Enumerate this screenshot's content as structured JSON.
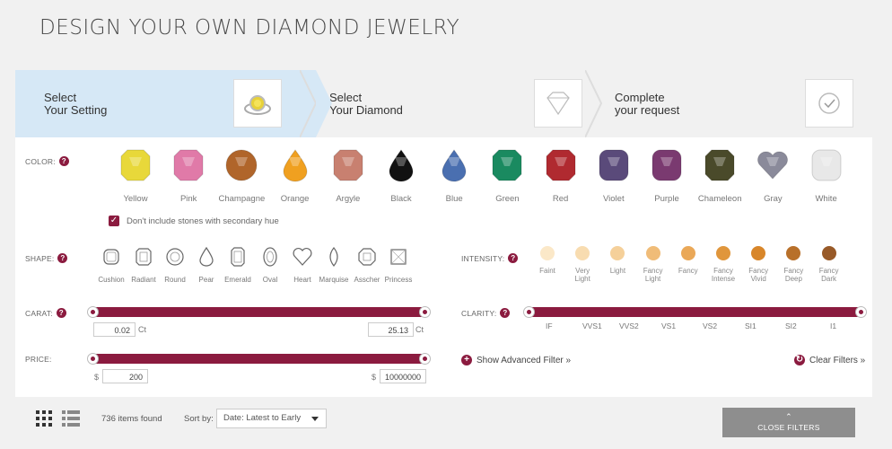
{
  "page": {
    "title": "DESIGN YOUR OWN DIAMOND JEWELRY"
  },
  "steps": [
    {
      "line1": "Select",
      "line2": "Your Setting"
    },
    {
      "line1": "Select",
      "line2": "Your Diamond"
    },
    {
      "line1": "Complete",
      "line2": "your request"
    }
  ],
  "filters": {
    "color_label": "COLOR:",
    "colors": [
      {
        "name": "Yellow",
        "hex": "#e8d83a"
      },
      {
        "name": "Pink",
        "hex": "#e07aa8"
      },
      {
        "name": "Champagne",
        "hex": "#b0652a"
      },
      {
        "name": "Orange",
        "hex": "#f0a020"
      },
      {
        "name": "Argyle",
        "hex": "#c88070"
      },
      {
        "name": "Black",
        "hex": "#111111"
      },
      {
        "name": "Blue",
        "hex": "#4a6fb0"
      },
      {
        "name": "Green",
        "hex": "#1a8a60"
      },
      {
        "name": "Red",
        "hex": "#b02a30"
      },
      {
        "name": "Violet",
        "hex": "#5a4a7a"
      },
      {
        "name": "Purple",
        "hex": "#7a3a70"
      },
      {
        "name": "Chameleon",
        "hex": "#4a4a2a"
      },
      {
        "name": "Gray",
        "hex": "#8a8a9a"
      },
      {
        "name": "White",
        "hex": "#e8e8e8"
      }
    ],
    "secondary_hue_label": "Don't include stones with secondary hue",
    "shape_label": "SHAPE:",
    "shapes": [
      "Cushion",
      "Radiant",
      "Round",
      "Pear",
      "Emerald",
      "Oval",
      "Heart",
      "Marquise",
      "Asscher",
      "Princess"
    ],
    "intensity_label": "INTENSITY:",
    "intensities": [
      {
        "l1": "Faint",
        "l2": "",
        "hex": "#fbe8c8"
      },
      {
        "l1": "Very",
        "l2": "Light",
        "hex": "#f8dcb0"
      },
      {
        "l1": "Light",
        "l2": "",
        "hex": "#f5d09a"
      },
      {
        "l1": "Fancy",
        "l2": "Light",
        "hex": "#f0bc78"
      },
      {
        "l1": "Fancy",
        "l2": "",
        "hex": "#eaa858"
      },
      {
        "l1": "Fancy",
        "l2": "Intense",
        "hex": "#e0963c"
      },
      {
        "l1": "Fancy",
        "l2": "Vivid",
        "hex": "#d8862a"
      },
      {
        "l1": "Fancy",
        "l2": "Deep",
        "hex": "#b8702a"
      },
      {
        "l1": "Fancy",
        "l2": "Dark",
        "hex": "#985a28"
      }
    ],
    "carat_label": "CARAT:",
    "carat_min": "0.02",
    "carat_max": "25.13",
    "carat_unit": "Ct",
    "clarity_label": "CLARITY:",
    "clarities": [
      "IF",
      "VVS1",
      "VVS2",
      "VS1",
      "VS2",
      "SI1",
      "SI2",
      "I1"
    ],
    "price_label": "PRICE:",
    "price_currency": "$",
    "price_min": "200",
    "price_max": "10000000",
    "advanced_filter": "Show Advanced Filter »",
    "clear_filters": "Clear Filters »"
  },
  "results": {
    "count": "736 items found",
    "sort_label": "Sort by:",
    "sort_value": "Date: Latest to Early",
    "close_filters": "CLOSE FILTERS"
  },
  "accent": "#8b1b3f"
}
